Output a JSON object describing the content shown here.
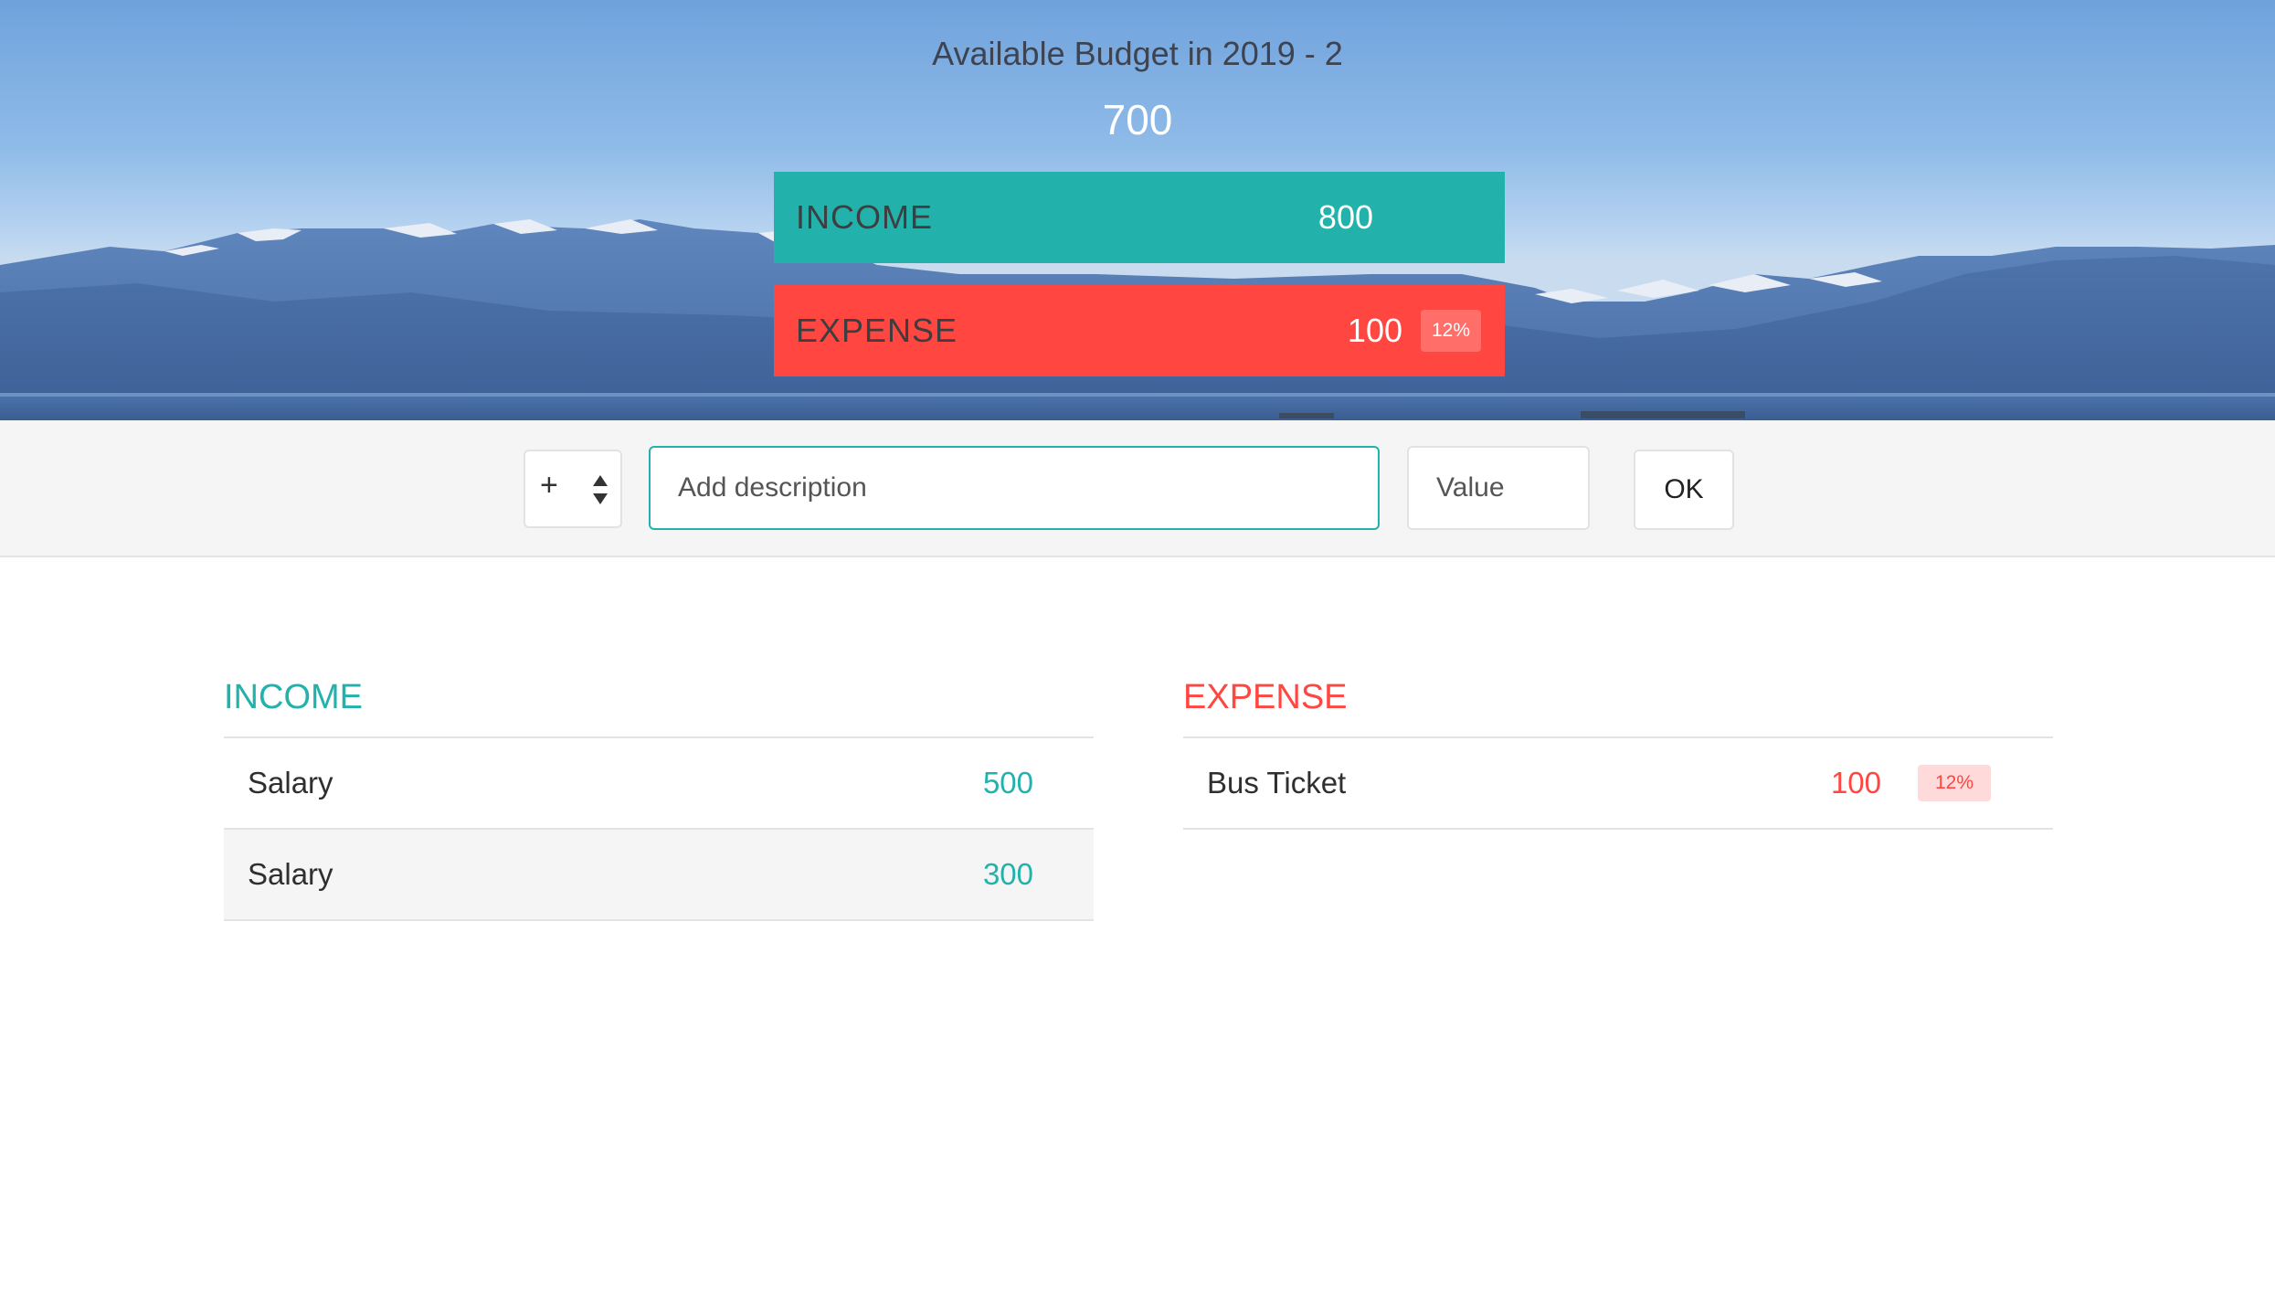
{
  "header": {
    "title": "Available Budget in 2019 - 2",
    "budget": "700",
    "income_label": "INCOME",
    "income_value": "800",
    "expense_label": "EXPENSE",
    "expense_value": "100",
    "expense_percentage": "12%"
  },
  "add_bar": {
    "type_selected": "+",
    "description_placeholder": "Add description",
    "value_placeholder": "Value",
    "ok_label": "OK"
  },
  "income": {
    "title": "INCOME",
    "items": [
      {
        "description": "Salary",
        "value": "500"
      },
      {
        "description": "Salary",
        "value": "300"
      }
    ]
  },
  "expense": {
    "title": "EXPENSE",
    "items": [
      {
        "description": "Bus Ticket",
        "value": "100",
        "percentage": "12%"
      }
    ]
  },
  "colors": {
    "income": "#23b2ab",
    "expense": "#ff4640",
    "expense_badge": "#ff6e68"
  },
  "icons": {
    "type_select_arrows": "up-down-arrows-icon"
  }
}
